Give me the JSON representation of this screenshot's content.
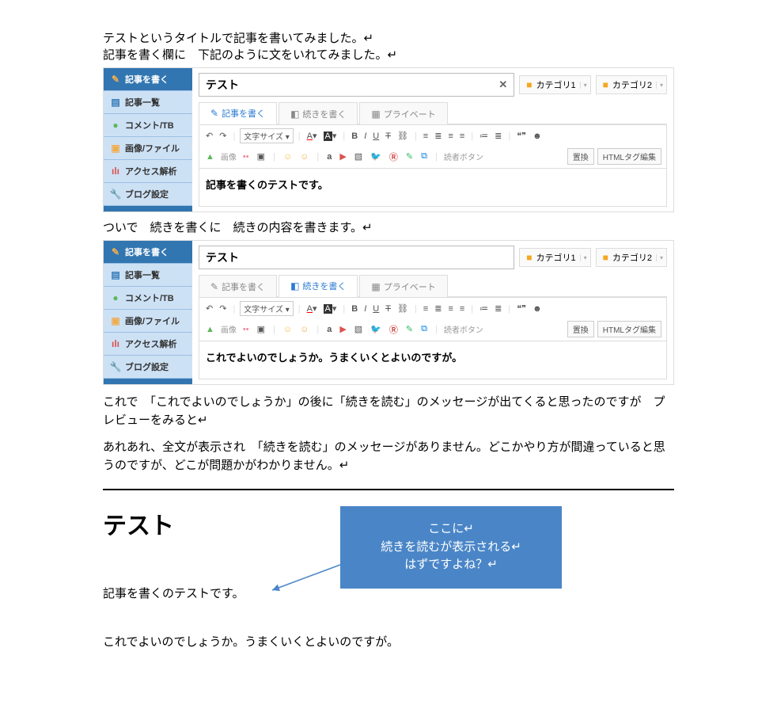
{
  "intro_line1": "テストというタイトルで記事を書いてみました。↵",
  "intro_line2": "記事を書く欄に　下記のように文をいれてみました。↵",
  "mid_line": "ついで　続きを書くに　続きの内容を書きます。↵",
  "para1": "これで　「これでよいのでしょうか」の後に「続きを読む」のメッセージが出てくると思ったのですが　プレビューをみると↵",
  "para2": "あれあれ、全文が表示され　「続きを読む」のメッセージがありません。どこかやり方が間違っていると思うのですが、どこが問題かがわかりません。↵",
  "sidebar": {
    "items": [
      {
        "label": "記事を書く",
        "icon": "✎",
        "color": "c-orange"
      },
      {
        "label": "記事一覧",
        "icon": "▤",
        "color": "c-blue"
      },
      {
        "label": "コメント/TB",
        "icon": "●",
        "color": "c-green"
      },
      {
        "label": "画像/ファイル",
        "icon": "▣",
        "color": "c-orange"
      },
      {
        "label": "アクセス解析",
        "icon": "ılı",
        "color": "c-red"
      },
      {
        "label": "ブログ設定",
        "icon": "✔",
        "color": "c-red"
      }
    ]
  },
  "title_value": "テスト",
  "clear_x": "✕",
  "categories": [
    {
      "label": "カテゴリ1"
    },
    {
      "label": "カテゴリ2"
    }
  ],
  "tabs": [
    {
      "label": "記事を書く",
      "icon": "✎"
    },
    {
      "label": "続きを書く",
      "icon": "▌◧"
    },
    {
      "label": "プライベート",
      "icon": "▦"
    }
  ],
  "toolbar": {
    "undo": "↶",
    "redo": "↷",
    "font_size": "文字サイズ ▾",
    "A_text": "A",
    "A_bg": "A",
    "bold": "B",
    "italic": "I",
    "underline": "U",
    "strike": "T",
    "link": "⛓",
    "align": [
      "≡",
      "≣",
      "≡",
      "≡"
    ],
    "list": [
      "≔",
      "≣"
    ],
    "quote": "❝❞",
    "emoji": "☻",
    "image_label": "画像",
    "flickr": "••",
    "photo": "▣",
    "smile1": "☺",
    "smile2": "☺",
    "amazon": "a",
    "youtube": "▶",
    "nico": "▧",
    "twitter": "🐦",
    "rakuten": "Ⓡ",
    "evernote": "✎",
    "dropbox": "⧉",
    "reader_btn": "読者ボタン",
    "replace": "置換",
    "html_edit": "HTMLタグ編集"
  },
  "content1": "記事を書くのテストです。",
  "content2": "これでよいのでしょうか。うまくいくとよいのですが。",
  "preview": {
    "heading": "テスト",
    "line1": "記事を書くのテストです。",
    "line2": "これでよいのでしょうか。うまくいくとよいのですが。"
  },
  "callout": {
    "l1": "ここに↵",
    "l2": "続きを読むが表示される↵",
    "l3": "はずですよね？↵"
  }
}
